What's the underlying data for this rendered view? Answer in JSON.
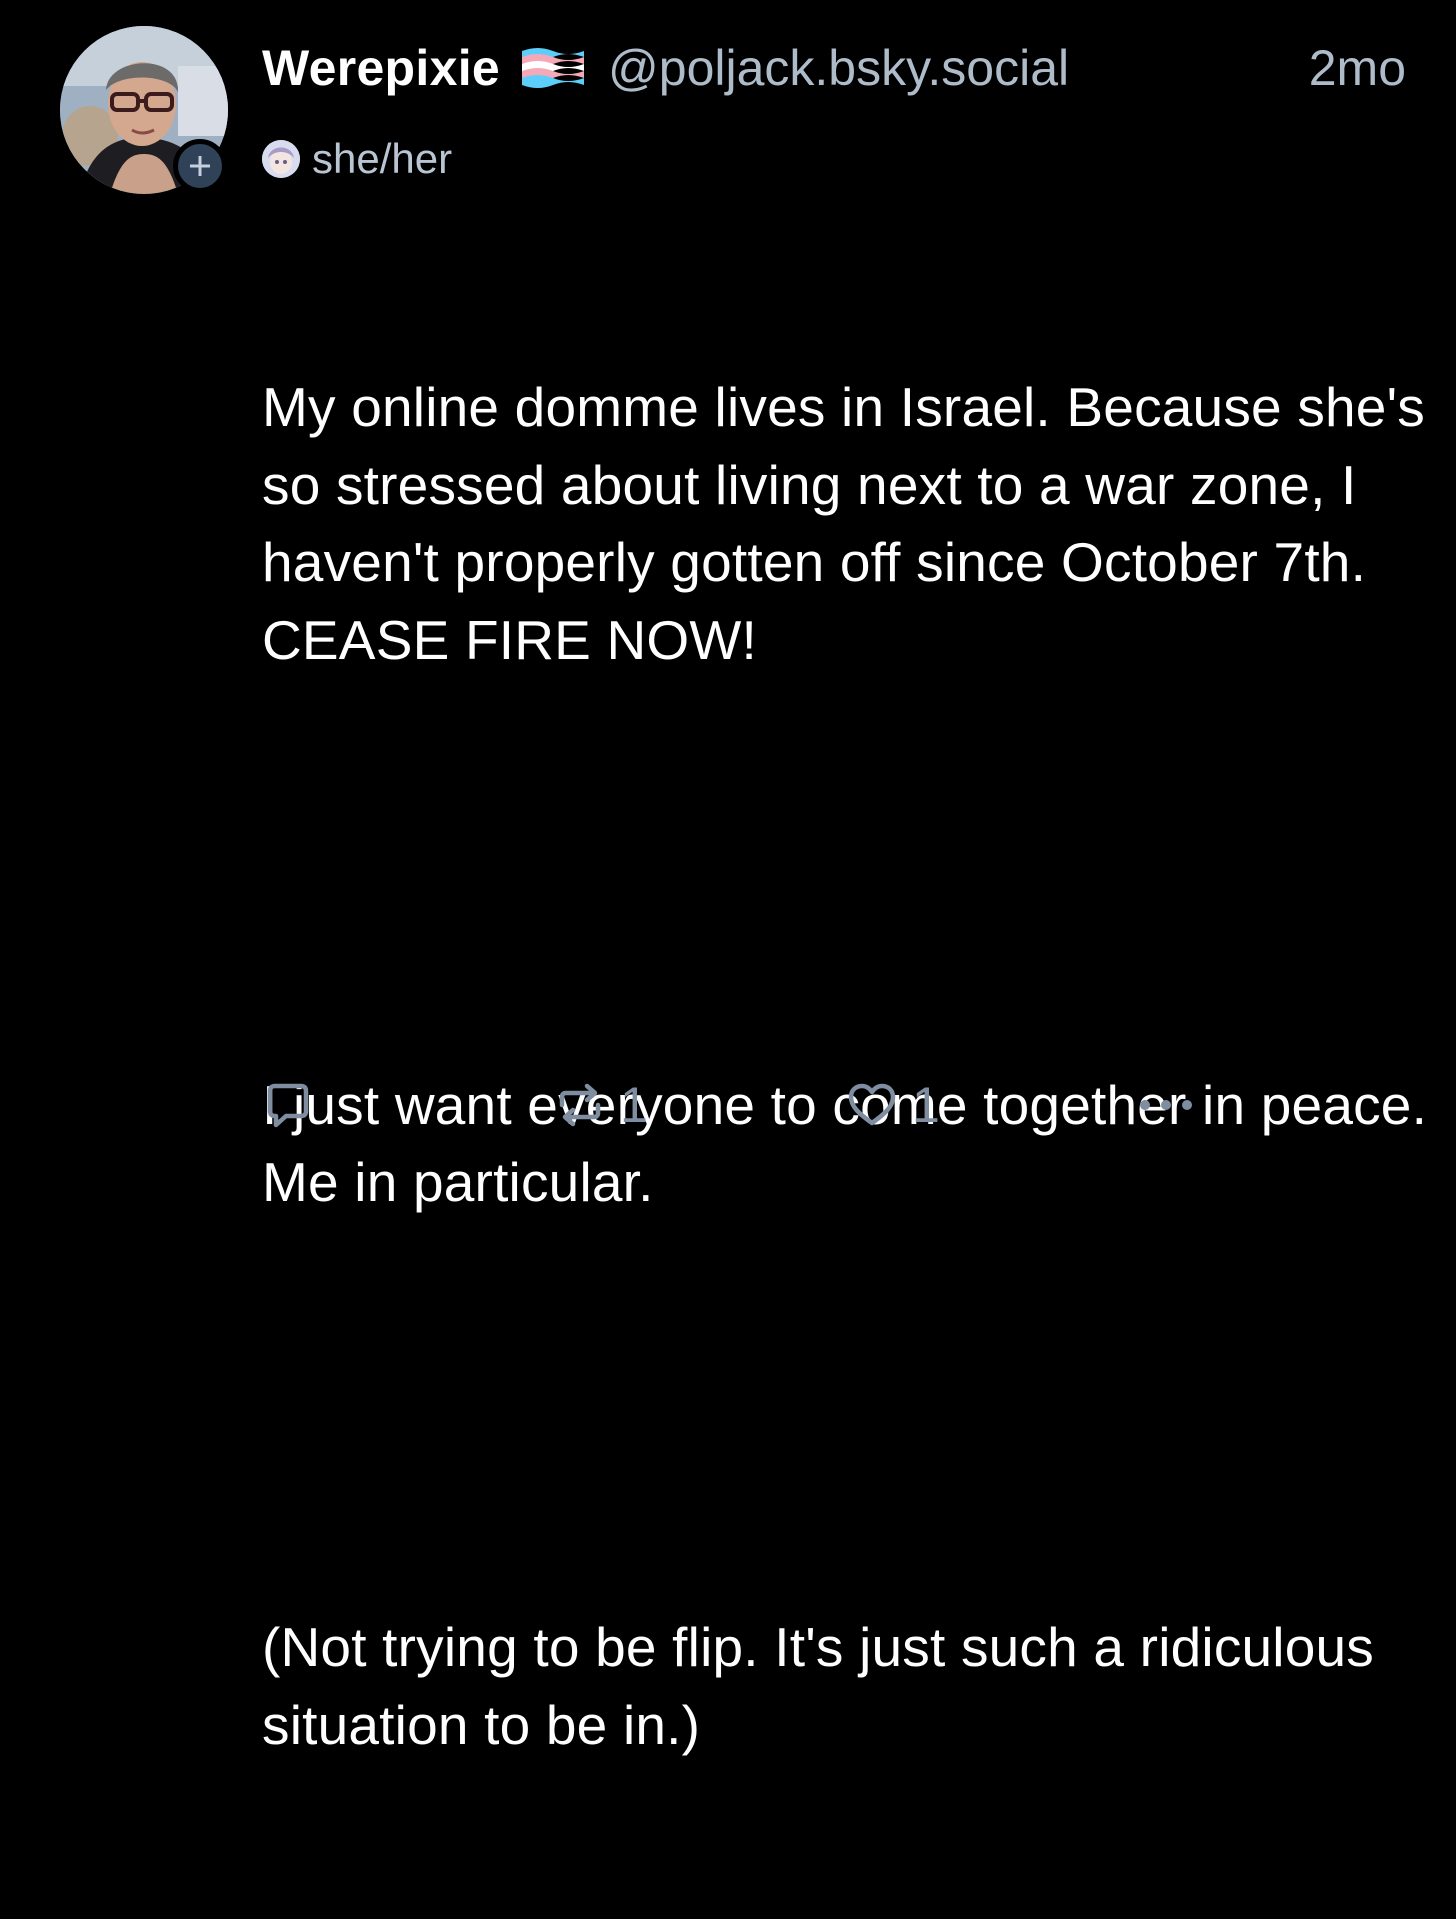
{
  "post": {
    "author": {
      "display_name": "Werepixie",
      "handle": "@poljack.bsky.social",
      "pronouns": "she/her",
      "avatar_icon": "user-avatar",
      "flag_icon": "transgender-flag-icon",
      "follow_icon": "plus-icon"
    },
    "timestamp": "2mo",
    "text": [
      "My online domme lives in Israel. Because she's so stressed about living next to a war zone, I haven't properly gotten off since October 7th. CEASE FIRE NOW!",
      "I just want everyone to come together in peace. Me in particular.",
      "(Not trying to be flip. It's just such a ridiculous situation to be in.)"
    ],
    "actions": {
      "reply_icon": "reply-icon",
      "repost_icon": "repost-icon",
      "repost_count": "1",
      "like_icon": "heart-icon",
      "like_count": "1",
      "more_icon": "more-icon"
    }
  },
  "colors": {
    "background": "#000000",
    "name": "#ffffff",
    "handle": "#aebbc9",
    "action": "#7e8ea0",
    "follow_badge": "#2f4258",
    "flag_blue": "#5bcefa",
    "flag_pink": "#f5a9b8",
    "flag_white": "#ffffff"
  }
}
